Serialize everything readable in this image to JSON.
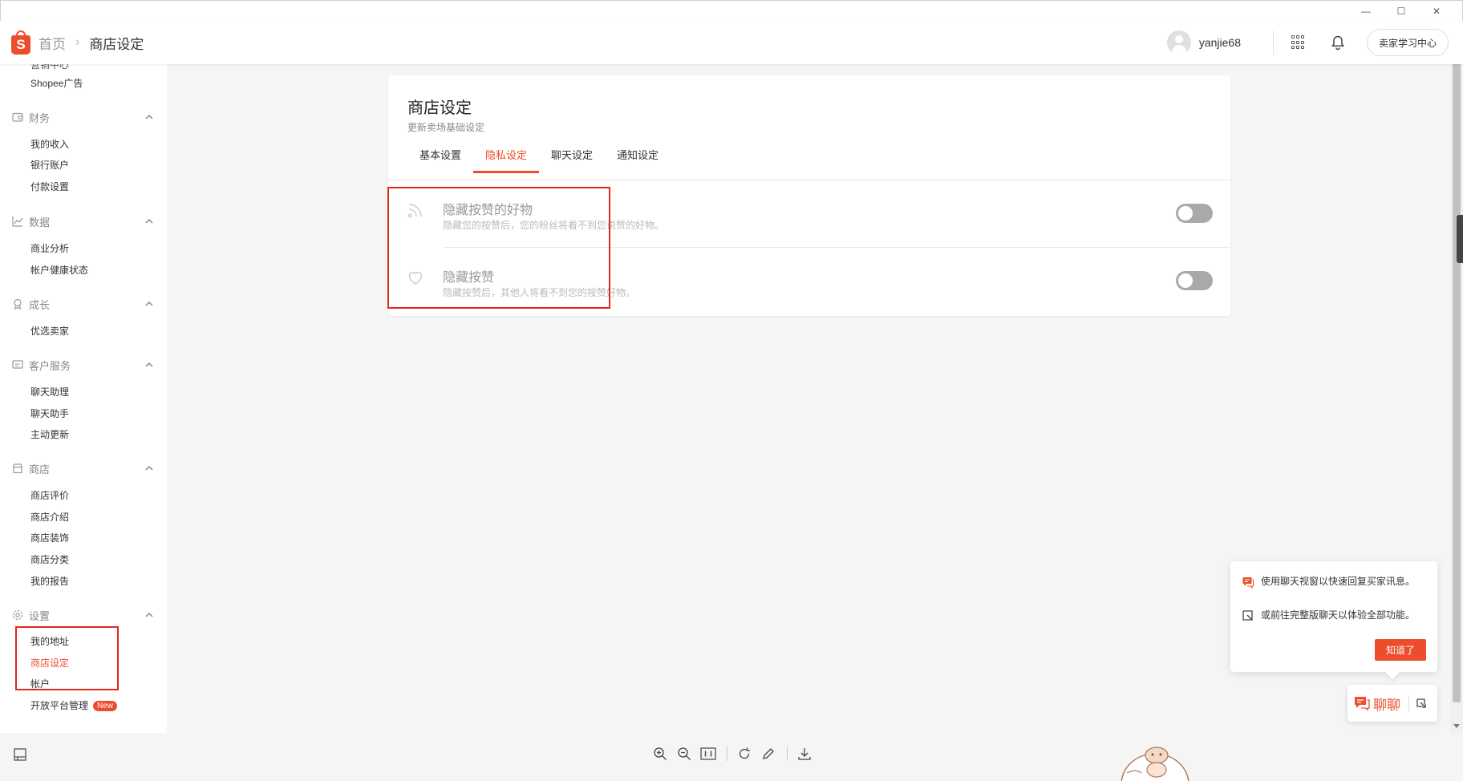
{
  "window": {
    "minimize": "—",
    "maximize": "☐",
    "close": "✕"
  },
  "header": {
    "logo_letter": "S",
    "breadcrumb_home": "首页",
    "breadcrumb_sep": "›",
    "breadcrumb_current": "商店设定",
    "username": "yanjie68",
    "learn_center": "卖家学习中心"
  },
  "sidebar": {
    "cut_off_top": "营销中心",
    "items_top": [
      "Shopee广告"
    ],
    "groups": [
      {
        "label": "财务",
        "icon": "wallet-icon",
        "items": [
          "我的收入",
          "银行账户",
          "付款设置"
        ]
      },
      {
        "label": "数据",
        "icon": "chart-icon",
        "items": [
          "商业分析",
          "帐户健康状态"
        ]
      },
      {
        "label": "成长",
        "icon": "badge-icon",
        "items": [
          "优选卖家"
        ]
      },
      {
        "label": "客户服务",
        "icon": "service-icon",
        "items": [
          "聊天助理",
          "聊天助手",
          "主动更新"
        ]
      },
      {
        "label": "商店",
        "icon": "shop-icon",
        "items": [
          "商店评价",
          "商店介绍",
          "商店装饰",
          "商店分类",
          "我的报告"
        ]
      },
      {
        "label": "设置",
        "icon": "gear-icon",
        "items": [
          "我的地址",
          "商店设定",
          "帐户",
          "开放平台管理"
        ]
      }
    ],
    "new_badge": "New",
    "active_item": "商店设定"
  },
  "card": {
    "title": "商店设定",
    "subtitle": "更新卖场基础设定",
    "tabs": [
      "基本设置",
      "隐私设定",
      "聊天设定",
      "通知设定"
    ],
    "active_tab": "隐私设定",
    "settings": [
      {
        "title": "隐藏按赞的好物",
        "desc": "隐藏您的按赞后，您的粉丝将看不到您说赞的好物。",
        "icon": "feed-icon",
        "enabled": false
      },
      {
        "title": "隐藏按赞",
        "desc": "隐藏按赞后，其他人将看不到您的按赞好物。",
        "icon": "heart-icon",
        "enabled": false
      }
    ]
  },
  "tip": {
    "line1": "使用聊天视窗以快速回复买家讯息。",
    "line2": "或前往完整版聊天以体验全部功能。",
    "ok": "知道了"
  },
  "chat": {
    "label": "聊聊"
  },
  "colors": {
    "brand": "#ee4d2d",
    "annotation": "#e0271f"
  }
}
